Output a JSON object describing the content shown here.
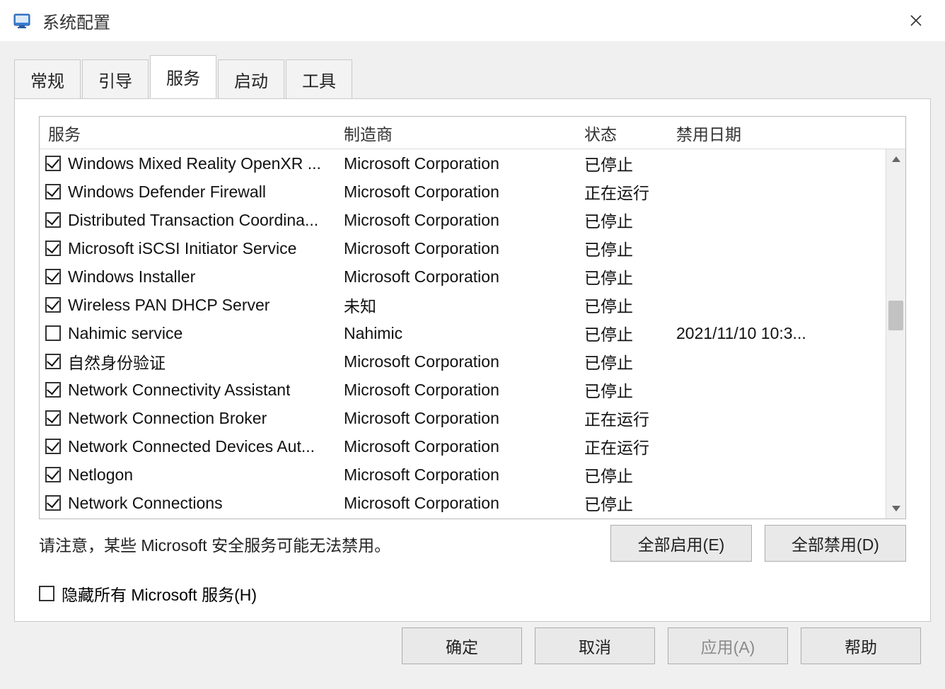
{
  "window": {
    "title": "系统配置"
  },
  "tabs": {
    "general": "常规",
    "boot": "引导",
    "services": "服务",
    "startup": "启动",
    "tools": "工具"
  },
  "columns": {
    "service": "服务",
    "manufacturer": "制造商",
    "status": "状态",
    "disable_date": "禁用日期"
  },
  "rows": [
    {
      "checked": true,
      "name": "Windows Mixed Reality OpenXR ...",
      "mfr": "Microsoft Corporation",
      "status": "已停止",
      "date": ""
    },
    {
      "checked": true,
      "name": "Windows Defender Firewall",
      "mfr": "Microsoft Corporation",
      "status": "正在运行",
      "date": ""
    },
    {
      "checked": true,
      "name": "Distributed Transaction Coordina...",
      "mfr": "Microsoft Corporation",
      "status": "已停止",
      "date": ""
    },
    {
      "checked": true,
      "name": "Microsoft iSCSI Initiator Service",
      "mfr": "Microsoft Corporation",
      "status": "已停止",
      "date": ""
    },
    {
      "checked": true,
      "name": "Windows Installer",
      "mfr": "Microsoft Corporation",
      "status": "已停止",
      "date": ""
    },
    {
      "checked": true,
      "name": "Wireless PAN DHCP Server",
      "mfr": "未知",
      "status": "已停止",
      "date": ""
    },
    {
      "checked": false,
      "name": "Nahimic service",
      "mfr": "Nahimic",
      "status": "已停止",
      "date": "2021/11/10 10:3..."
    },
    {
      "checked": true,
      "name": "自然身份验证",
      "mfr": "Microsoft Corporation",
      "status": "已停止",
      "date": ""
    },
    {
      "checked": true,
      "name": "Network Connectivity Assistant",
      "mfr": "Microsoft Corporation",
      "status": "已停止",
      "date": ""
    },
    {
      "checked": true,
      "name": "Network Connection Broker",
      "mfr": "Microsoft Corporation",
      "status": "正在运行",
      "date": ""
    },
    {
      "checked": true,
      "name": "Network Connected Devices Aut...",
      "mfr": "Microsoft Corporation",
      "status": "正在运行",
      "date": ""
    },
    {
      "checked": true,
      "name": "Netlogon",
      "mfr": "Microsoft Corporation",
      "status": "已停止",
      "date": ""
    },
    {
      "checked": true,
      "name": "Network Connections",
      "mfr": "Microsoft Corporation",
      "status": "已停止",
      "date": ""
    }
  ],
  "note": "请注意，某些 Microsoft 安全服务可能无法禁用。",
  "enable_all": "全部启用(E)",
  "disable_all": "全部禁用(D)",
  "hide_ms": "隐藏所有 Microsoft 服务(H)",
  "buttons": {
    "ok": "确定",
    "cancel": "取消",
    "apply": "应用(A)",
    "help": "帮助"
  }
}
